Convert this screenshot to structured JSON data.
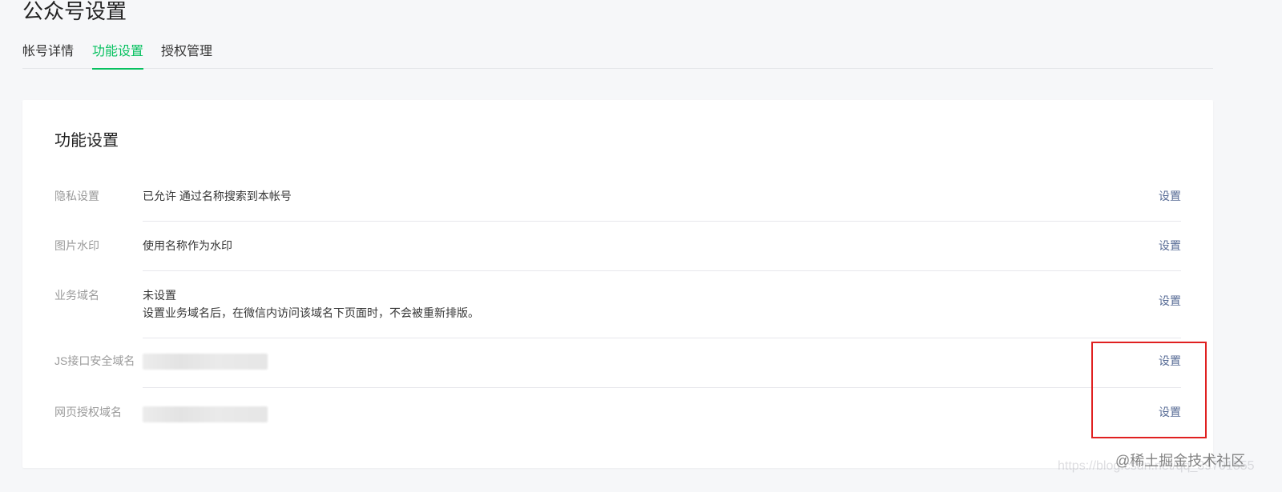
{
  "page": {
    "title": "公众号设置"
  },
  "tabs": [
    {
      "label": "帐号详情",
      "active": false
    },
    {
      "label": "功能设置",
      "active": true
    },
    {
      "label": "授权管理",
      "active": false
    }
  ],
  "card": {
    "title": "功能设置",
    "rows": [
      {
        "label": "隐私设置",
        "value_lines": [
          "已允许 通过名称搜索到本帐号"
        ],
        "action": "设置"
      },
      {
        "label": "图片水印",
        "value_lines": [
          "使用名称作为水印"
        ],
        "action": "设置"
      },
      {
        "label": "业务域名",
        "value_lines": [
          "未设置",
          "设置业务域名后，在微信内访问该域名下页面时，不会被重新排版。"
        ],
        "action": "设置"
      },
      {
        "label": "JS接口安全域名",
        "value_lines": [],
        "action": "设置"
      },
      {
        "label": "网页授权域名",
        "value_lines": [],
        "action": "设置"
      }
    ]
  },
  "watermark": {
    "url": "https://blog.csdn.net/qq_39701555",
    "juejin": "@稀土掘金技术社区"
  },
  "colors": {
    "accent": "#07c160",
    "link": "#576b95",
    "highlight": "#e02020"
  }
}
